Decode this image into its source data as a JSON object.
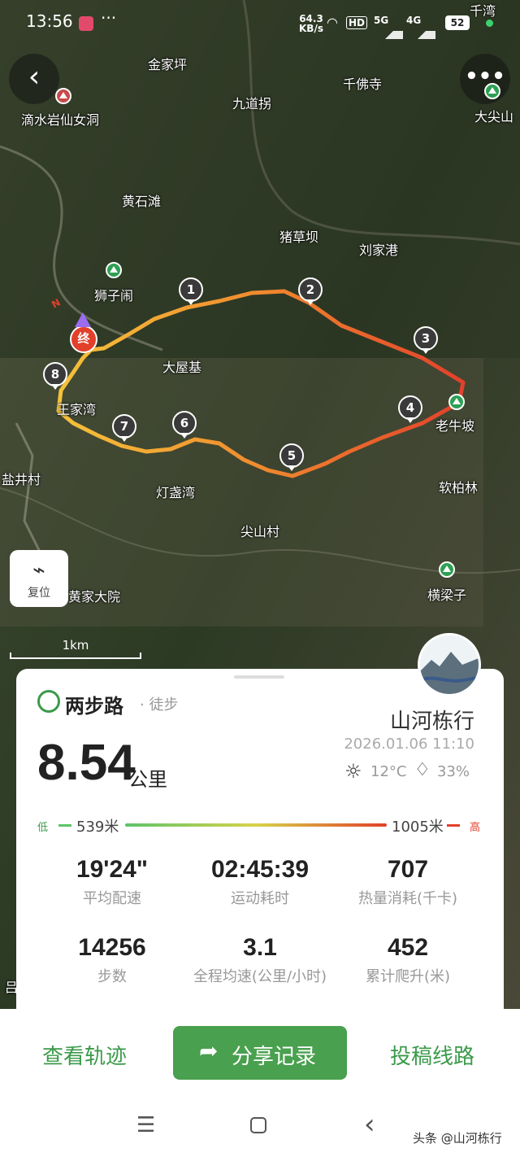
{
  "status_bar": {
    "time": "13:56",
    "speed_value": "64.3",
    "speed_unit": "KB/s",
    "hd": "HD",
    "net1": "5G",
    "net2": "4G",
    "battery": "52"
  },
  "map": {
    "places": [
      "金家坪",
      "九道拐",
      "千佛寺",
      "滴水岩仙女洞",
      "大尖山",
      "黄石滩",
      "猪草坝",
      "刘家港",
      "狮子闹",
      "大屋基",
      "王家湾",
      "老牛坡",
      "灯盏湾",
      "软柏林",
      "盐井村",
      "尖山村",
      "黄家大院",
      "横梁子",
      "千湾",
      "吕"
    ],
    "waypoints": [
      "1",
      "2",
      "3",
      "4",
      "5",
      "6",
      "7",
      "8"
    ],
    "end_marker": "终",
    "north_label": "N",
    "reset_label": "复位",
    "scale_label": "1km"
  },
  "card": {
    "brand": "两步路",
    "sport": "· 徒步",
    "user": "山河栋行",
    "datetime": "2026.01.06 11:10",
    "distance_value": "8.54",
    "distance_unit": "公里",
    "temperature": "12°C",
    "humidity": "33%",
    "elevation": {
      "low_label": "低",
      "low_value": "539米",
      "high_value": "1005米",
      "high_label": "高"
    },
    "stats": [
      {
        "value": "19'24\"",
        "label": "平均配速"
      },
      {
        "value": "02:45:39",
        "label": "运动耗时"
      },
      {
        "value": "707",
        "label": "热量消耗(千卡)"
      },
      {
        "value": "14256",
        "label": "步数"
      },
      {
        "value": "3.1",
        "label": "全程均速(公里/小时)"
      },
      {
        "value": "452",
        "label": "累计爬升(米)"
      }
    ]
  },
  "actions": {
    "view_track": "查看轨迹",
    "share": "分享记录",
    "submit_route": "投稿线路"
  },
  "watermark": "头条 @山河栋行",
  "colors": {
    "accent": "#3b9a4a",
    "share_button": "#49a04e",
    "track_start": "#f5c23a",
    "track_end": "#e2402b"
  }
}
